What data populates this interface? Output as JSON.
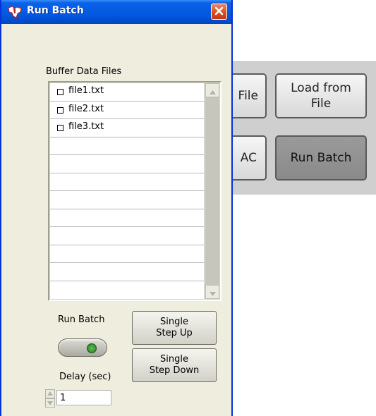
{
  "window": {
    "title": "Run Batch"
  },
  "background_panel": {
    "btn_file_partial": "File",
    "btn_load_from_file": "Load from\nFile",
    "btn_dac_partial": "AC",
    "btn_run_batch": "Run Batch"
  },
  "listbox": {
    "label": "Buffer Data Files",
    "items": [
      "file1.txt",
      "file2.txt",
      "file3.txt"
    ]
  },
  "controls": {
    "run_batch_label": "Run Batch",
    "single_step_up": "Single\nStep Up",
    "single_step_down": "Single\nStep Down",
    "delay_label": "Delay (sec)",
    "delay_value": "1"
  },
  "colors": {
    "titlebar": "#0358e0",
    "window_bg": "#efedde",
    "led": "#3fa03a"
  },
  "icons": {
    "app": "ti-logo-icon",
    "close": "close-x-icon",
    "checkbox": "checkbox-icon",
    "scroll_up": "scroll-up-arrow-icon",
    "scroll_down": "scroll-down-arrow-icon"
  }
}
